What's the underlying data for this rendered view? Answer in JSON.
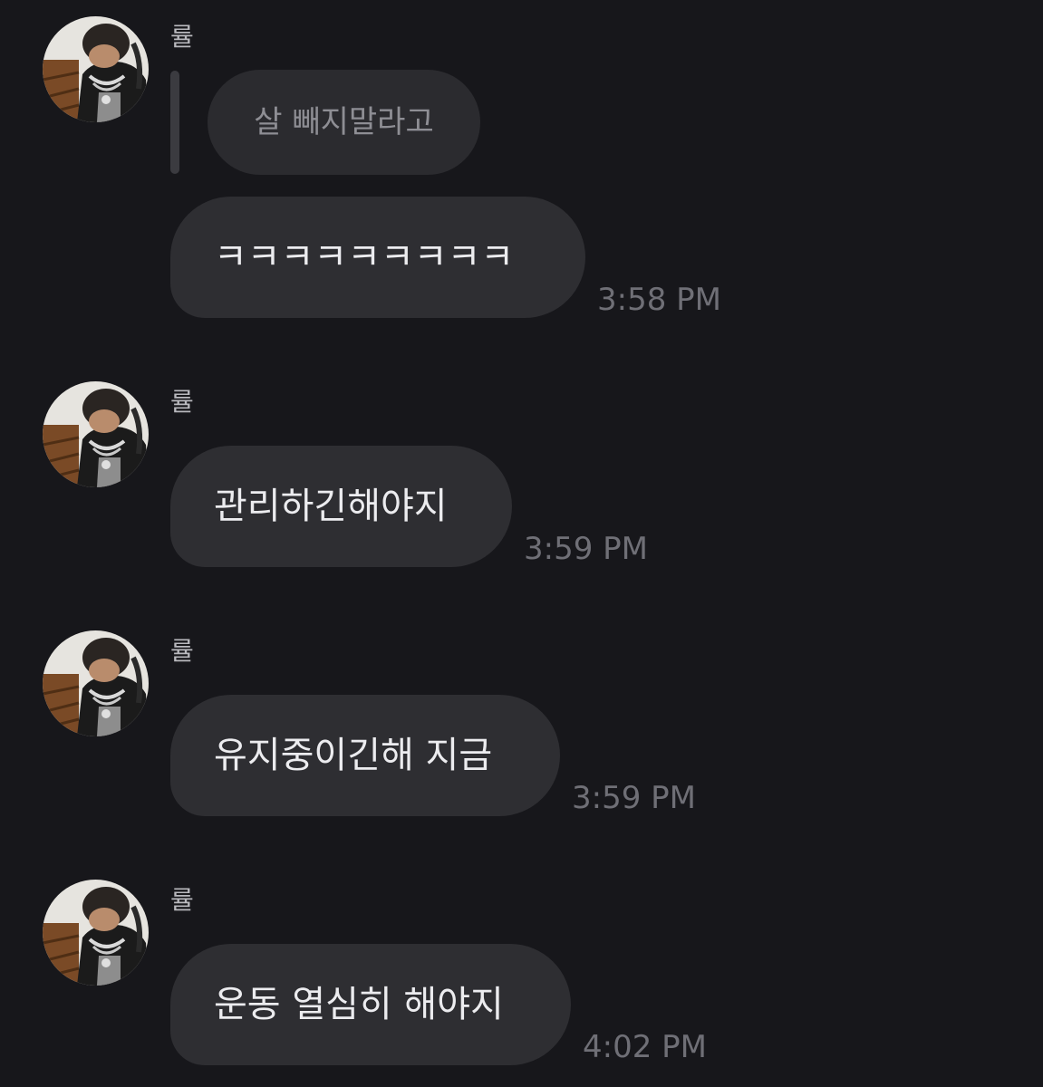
{
  "messages": [
    {
      "sender": "률",
      "reply_quote": "살 빼지말라고",
      "text": "ㅋㅋㅋㅋㅋㅋㅋㅋㅋ",
      "time": "3:58 PM"
    },
    {
      "sender": "률",
      "text": "관리하긴해야지",
      "time": "3:59 PM"
    },
    {
      "sender": "률",
      "text": "유지중이긴해 지금",
      "time": "3:59 PM"
    },
    {
      "sender": "률",
      "text": "운동 열심히 해야지",
      "time": "4:02 PM"
    }
  ],
  "colors": {
    "background": "#17171b",
    "bubble": "#2e2e32",
    "reply_bubble": "#2b2b2f",
    "timestamp": "#6f6f76"
  }
}
